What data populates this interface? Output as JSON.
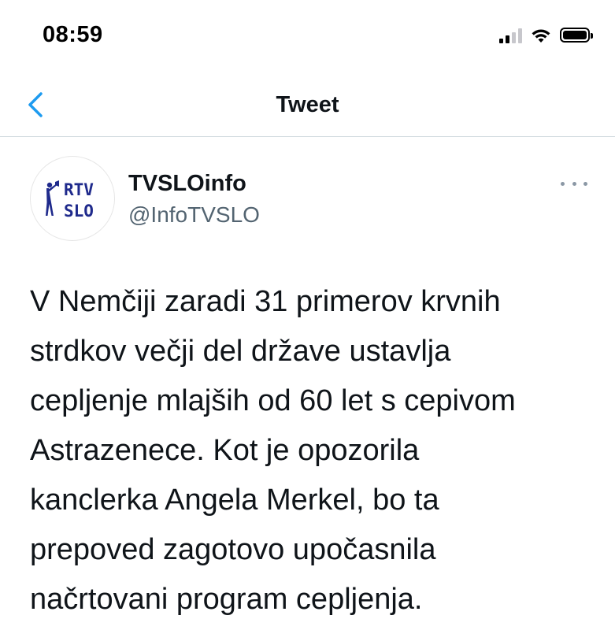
{
  "status_bar": {
    "time": "08:59",
    "icons": [
      "cellular-signal-icon",
      "wifi-icon",
      "battery-icon"
    ]
  },
  "nav": {
    "back_icon": "chevron-left-icon",
    "title": "Tweet",
    "accent_color": "#1d9bf0"
  },
  "tweet": {
    "author": {
      "display_name": "TVSLOinfo",
      "handle": "@InfoTVSLO",
      "avatar": {
        "logo_line1": "RTV",
        "logo_line2": "SLO",
        "logo_color": "#1f2a8c"
      }
    },
    "more_icon": "more-horizontal-icon",
    "text": "V Nemčiji zaradi 31 primerov krvnih\nstrdkov večji del države ustavlja\ncepljenje mlajših od 60 let s cepivom\nAstrazenece. Kot je opozorila\nkanclerka Angela Merkel, bo ta\nprepoved zagotovo upočasnila\nnačrtovani program cepljenja."
  }
}
